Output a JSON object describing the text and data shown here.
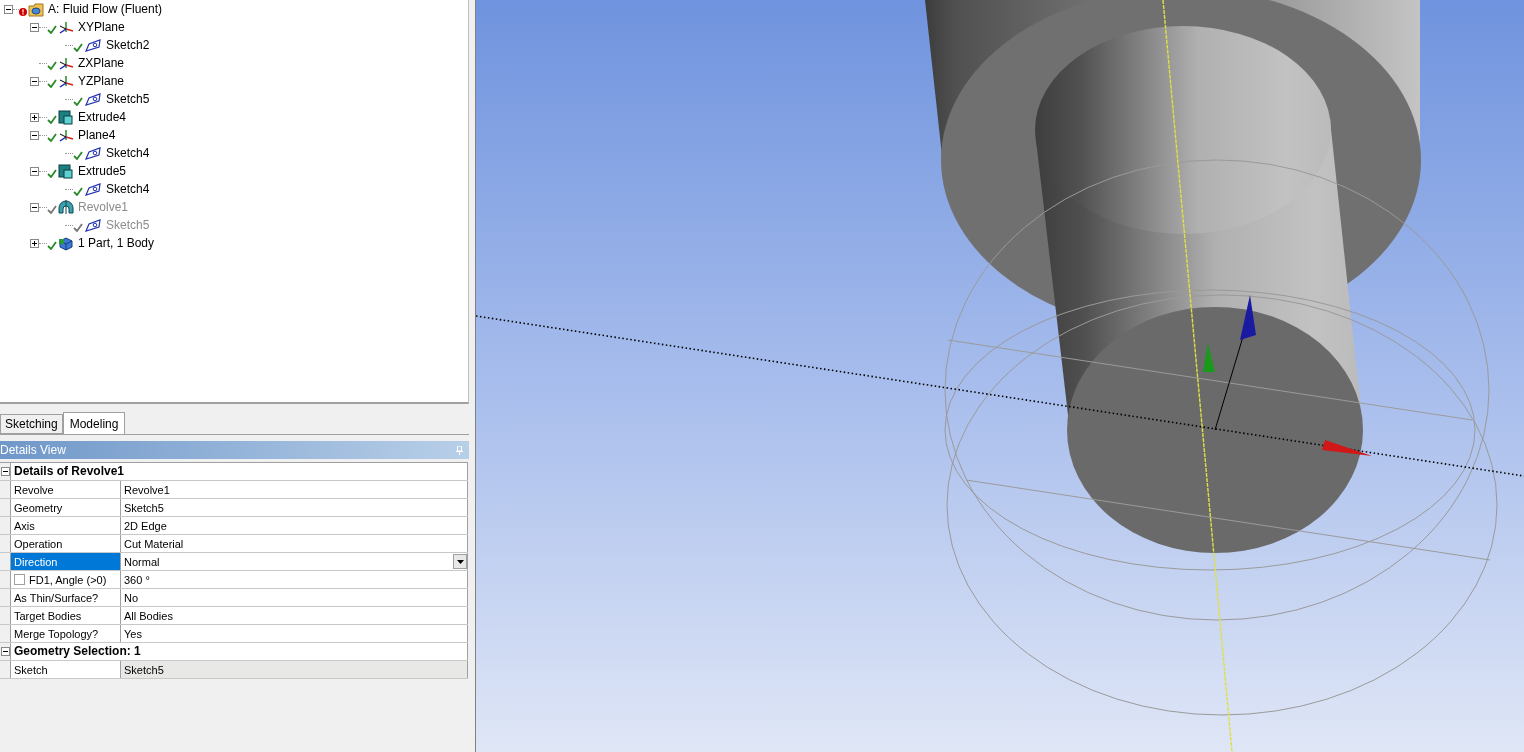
{
  "tree": {
    "label": "A: Fluid Flow (Fluent)",
    "kind": "root",
    "warning": true,
    "expanded": true,
    "suppressed": false,
    "children": [
      {
        "label": "XYPlane",
        "kind": "plane",
        "expanded": true,
        "suppressed": false,
        "children": [
          {
            "label": "Sketch2",
            "kind": "sketch",
            "suppressed": false
          }
        ]
      },
      {
        "label": "ZXPlane",
        "kind": "plane",
        "suppressed": false
      },
      {
        "label": "YZPlane",
        "kind": "plane",
        "expanded": true,
        "suppressed": false,
        "children": [
          {
            "label": "Sketch5",
            "kind": "sketch",
            "suppressed": false
          }
        ]
      },
      {
        "label": "Extrude4",
        "kind": "extrude",
        "expanded": false,
        "suppressed": false
      },
      {
        "label": "Plane4",
        "kind": "plane",
        "expanded": true,
        "suppressed": false,
        "children": [
          {
            "label": "Sketch4",
            "kind": "sketch",
            "suppressed": false
          }
        ]
      },
      {
        "label": "Extrude5",
        "kind": "extrude",
        "expanded": true,
        "suppressed": false,
        "children": [
          {
            "label": "Sketch4",
            "kind": "sketch",
            "suppressed": false
          }
        ]
      },
      {
        "label": "Revolve1",
        "kind": "revolve",
        "expanded": true,
        "suppressed": true,
        "children": [
          {
            "label": "Sketch5",
            "kind": "sketch",
            "suppressed": true
          }
        ]
      },
      {
        "label": "1 Part, 1 Body",
        "kind": "body",
        "expanded": false,
        "suppressed": false
      }
    ]
  },
  "tabs": [
    {
      "label": "Sketching",
      "selected": false
    },
    {
      "label": "Modeling",
      "selected": true
    }
  ],
  "details": {
    "title": "Details View",
    "groups": [
      {
        "title": "Details of Revolve1",
        "expanded": true,
        "rows": [
          {
            "label": "Revolve",
            "value": "Revolve1",
            "kind": "text",
            "selected": false,
            "readonly": false
          },
          {
            "label": "Geometry",
            "value": "Sketch5",
            "kind": "text",
            "selected": false,
            "readonly": false
          },
          {
            "label": "Axis",
            "value": "2D Edge",
            "kind": "text",
            "selected": false,
            "readonly": false
          },
          {
            "label": "Operation",
            "value": "Cut Material",
            "kind": "text",
            "selected": false,
            "readonly": false
          },
          {
            "label": "Direction",
            "value": "Normal",
            "kind": "dropdown",
            "selected": true,
            "readonly": false
          },
          {
            "label": "FD1,  Angle (>0)",
            "value": "360 °",
            "kind": "checkbox",
            "checked": false,
            "selected": false,
            "readonly": false
          },
          {
            "label": "As Thin/Surface?",
            "value": "No",
            "kind": "text",
            "selected": false,
            "readonly": false
          },
          {
            "label": "Target Bodies",
            "value": "All Bodies",
            "kind": "text",
            "selected": false,
            "readonly": false
          },
          {
            "label": "Merge Topology?",
            "value": "Yes",
            "kind": "text",
            "selected": false,
            "readonly": false
          }
        ]
      },
      {
        "title": "Geometry Selection: 1",
        "expanded": true,
        "rows": [
          {
            "label": "Sketch",
            "value": "Sketch5",
            "kind": "text",
            "selected": false,
            "readonly": true
          }
        ]
      }
    ]
  }
}
